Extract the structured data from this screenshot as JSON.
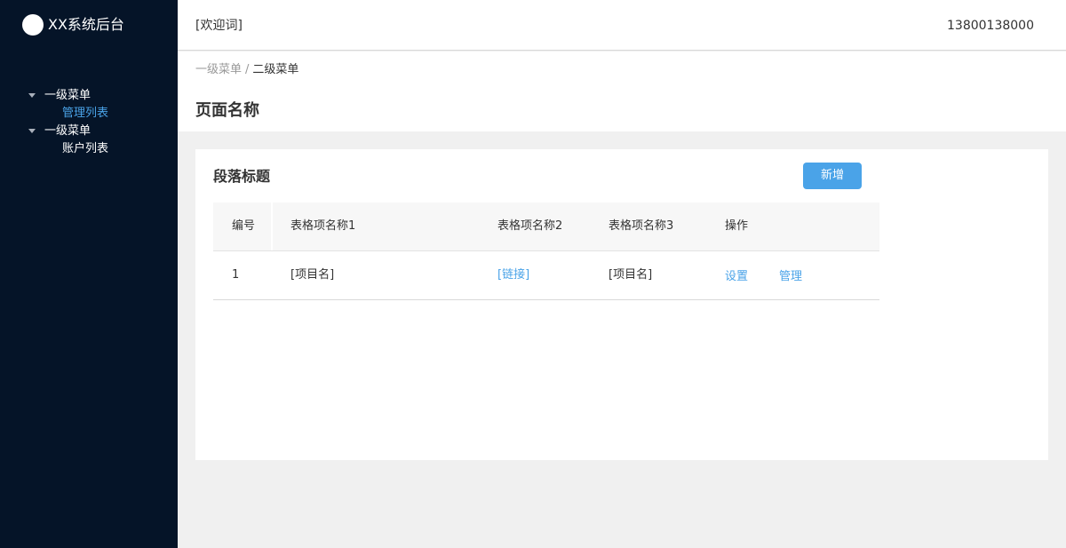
{
  "app": {
    "title": "XX系统后台"
  },
  "sidebar": {
    "groups": [
      {
        "label": "一级菜单",
        "items": [
          {
            "label": "管理列表",
            "active": true
          }
        ]
      },
      {
        "label": "一级菜单",
        "items": [
          {
            "label": "账户列表",
            "active": false
          }
        ]
      }
    ]
  },
  "header": {
    "welcome": "[欢迎词]",
    "user": "13800138000"
  },
  "breadcrumb": {
    "parent": "一级菜单",
    "separator": "/",
    "current": "二级菜单"
  },
  "page": {
    "title": "页面名称"
  },
  "section": {
    "title": "段落标题",
    "add_label": "新增"
  },
  "table": {
    "headers": [
      "编号",
      "表格项名称1",
      "表格项名称2",
      "表格项名称3",
      "操作"
    ],
    "rows": [
      {
        "id": "1",
        "name1": "[项目名]",
        "name2": "[链接]",
        "name3": "[项目名]",
        "actions": [
          "设置",
          "管理"
        ]
      }
    ]
  },
  "colors": {
    "sidebar_bg": "#051428",
    "accent": "#4aa3e8",
    "page_bg": "#f0f0f0"
  },
  "icons": {
    "logo": "circle-logo-icon",
    "menu_caret": "caret-down-icon"
  }
}
